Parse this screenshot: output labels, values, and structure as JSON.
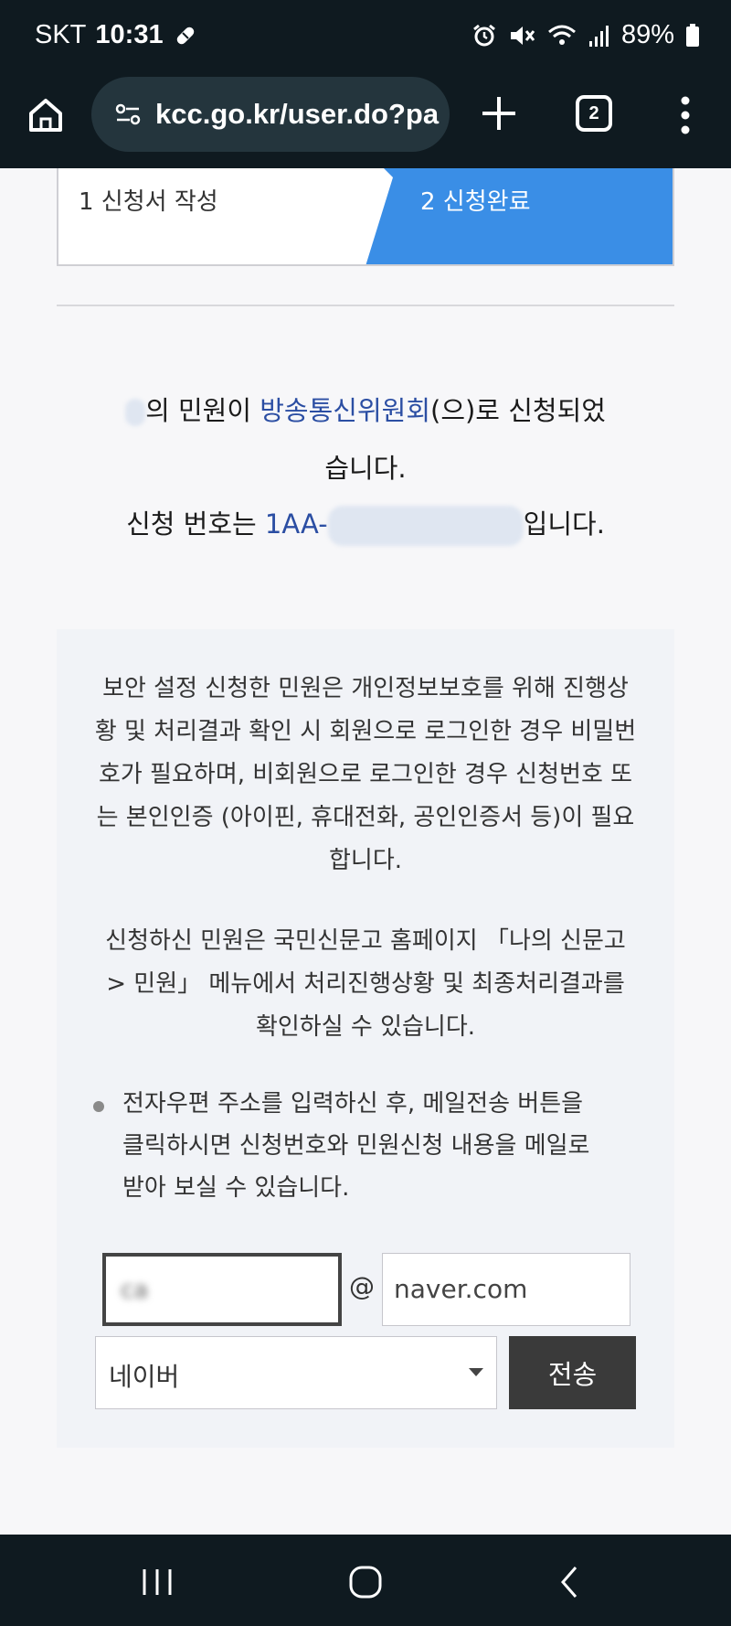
{
  "status_bar": {
    "carrier": "SKT",
    "time": "10:31",
    "battery": "89%",
    "icons": [
      "pill-icon",
      "alarm-icon",
      "mute-icon",
      "wifi-icon",
      "signal-icon",
      "battery-icon"
    ]
  },
  "browser": {
    "url": "kcc.go.kr/user.do?pa",
    "tab_count": "2"
  },
  "steps": {
    "step1": "1 신청서 작성",
    "step2": "2 신청완료",
    "active_color": "#3a8ee6"
  },
  "message": {
    "line1_pre": "의 민원이 ",
    "agency": "방송통신위원회",
    "line1_post": "(으)로 신청되었",
    "line2": "습니다.",
    "line3_pre": "신청 번호는 ",
    "app_no_visible": "1AA-",
    "line3_post": "입니다."
  },
  "info": {
    "para1": "보안 설정 신청한 민원은 개인정보보호를 위해 진행상황 및 처리결과 확인 시 회원으로 로그인한 경우 비밀번호가 필요하며, 비회원으로 로그인한 경우 신청번호 또는 본인인증 (아이핀, 휴대전화, 공인인증서 등)이 필요합니다.",
    "para2": "신청하신 민원은 국민신문고 홈페이지 「나의 신문고 > 민원」 메뉴에서 처리진행상황 및 최종처리결과를 확인하실 수 있습니다.",
    "bullet": "전자우편 주소를 입력하신 후, 메일전송 버튼을 클릭하시면 신청번호와 민원신청 내용을 메일로 받아 보실 수 있습니다."
  },
  "email_form": {
    "local_part": "ca",
    "at": "@",
    "domain": "naver.com",
    "domain_select": "네이버",
    "send_label": "전송"
  },
  "nav_icons": [
    "recent-apps-icon",
    "home-circle-icon",
    "back-icon"
  ]
}
